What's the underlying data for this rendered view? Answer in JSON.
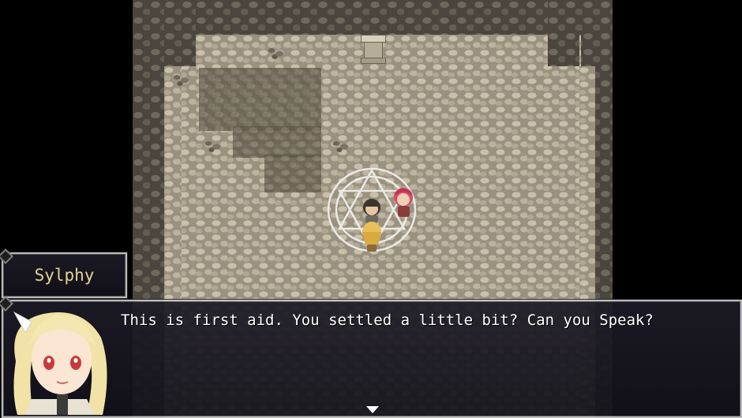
{
  "scene": {
    "location": "",
    "floor_color": "#9a9280",
    "wall_color": "#4a463e",
    "magic_circle_color": "#f2f2f2"
  },
  "dialogue": {
    "speaker": "Sylphy",
    "message": "This is first aid. You settled a little bit? Can you Speak?",
    "continue_indicator": "triangle-down-icon"
  },
  "colors": {
    "name_text": "#f3e3a3",
    "message_text": "#ffffff",
    "window_bg": "#1d1b26",
    "window_border": "#c9c9c9"
  }
}
